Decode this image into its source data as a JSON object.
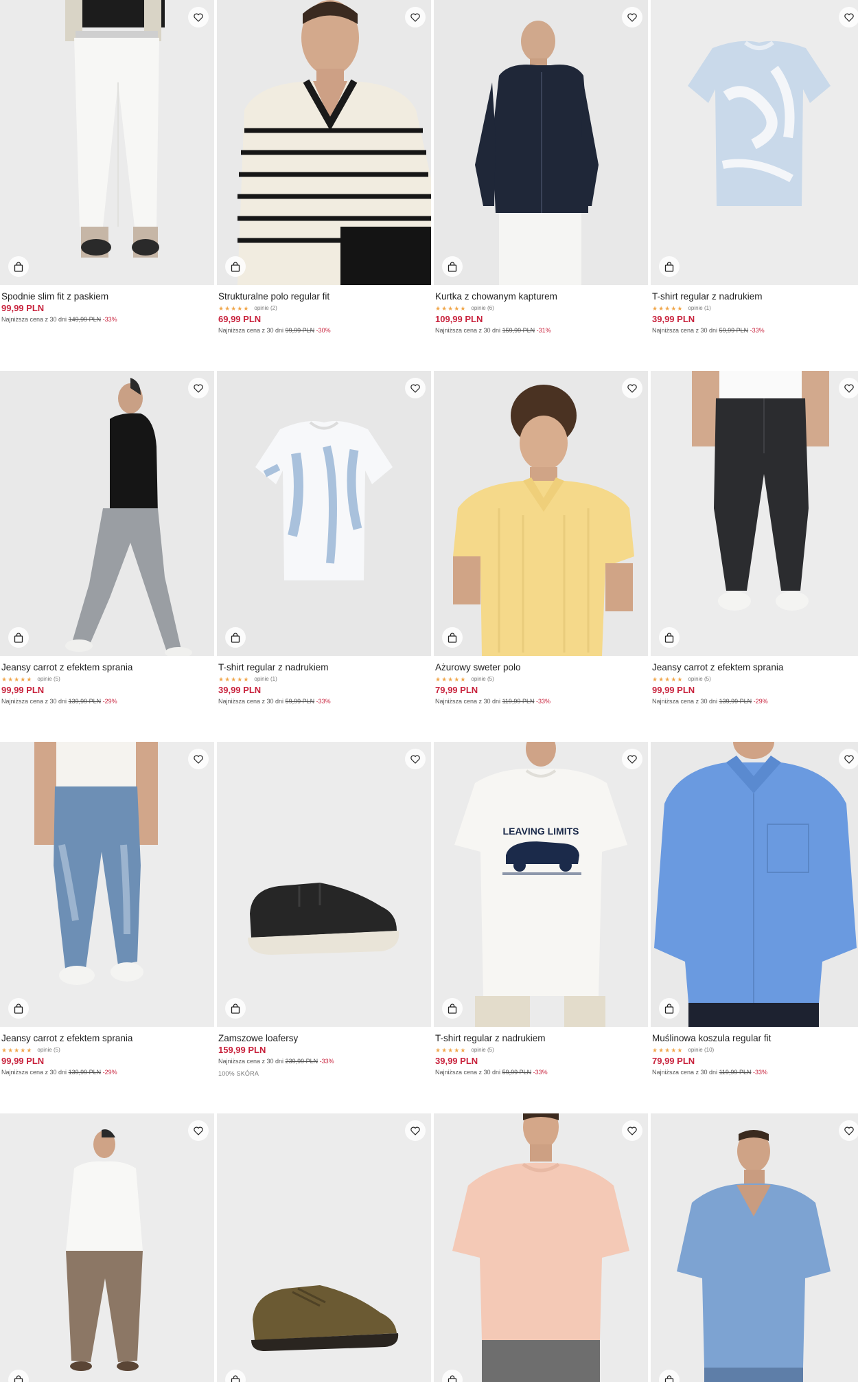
{
  "products": [
    {
      "name": "Spodnie slim fit z paskiem",
      "rating": null,
      "price": "99,99 PLN",
      "lowest_label": "Najniższa cena z 30 dni",
      "old_price": "149,99 PLN",
      "discount": "-33%"
    },
    {
      "name": "Strukturalne polo regular fit",
      "rating": {
        "stars": 5,
        "opinions": "opinie (2)"
      },
      "price": "69,99 PLN",
      "lowest_label": "Najniższa cena z 30 dni",
      "old_price": "99,99 PLN",
      "discount": "-30%"
    },
    {
      "name": "Kurtka z chowanym kapturem",
      "rating": {
        "stars": 5,
        "opinions": "opinie (6)"
      },
      "price": "109,99 PLN",
      "lowest_label": "Najniższa cena z 30 dni",
      "old_price": "159,99 PLN",
      "discount": "-31%"
    },
    {
      "name": "T-shirt regular z nadrukiem",
      "rating": {
        "stars": 5,
        "opinions": "opinie (1)"
      },
      "price": "39,99 PLN",
      "lowest_label": "Najniższa cena z 30 dni",
      "old_price": "59,99 PLN",
      "discount": "-33%"
    },
    {
      "name": "Jeansy carrot z efektem sprania",
      "rating": {
        "stars": 5,
        "opinions": "opinie (5)"
      },
      "price": "99,99 PLN",
      "lowest_label": "Najniższa cena z 30 dni",
      "old_price": "139,99 PLN",
      "discount": "-29%"
    },
    {
      "name": "T-shirt regular z nadrukiem",
      "rating": {
        "stars": 5,
        "opinions": "opinie (1)"
      },
      "price": "39,99 PLN",
      "lowest_label": "Najniższa cena z 30 dni",
      "old_price": "59,99 PLN",
      "discount": "-33%"
    },
    {
      "name": "Ażurowy sweter polo",
      "rating": {
        "stars": 5,
        "opinions": "opinie (5)"
      },
      "price": "79,99 PLN",
      "lowest_label": "Najniższa cena z 30 dni",
      "old_price": "119,99 PLN",
      "discount": "-33%"
    },
    {
      "name": "Jeansy carrot z efektem sprania",
      "rating": {
        "stars": 5,
        "opinions": "opinie (5)"
      },
      "price": "99,99 PLN",
      "lowest_label": "Najniższa cena z 30 dni",
      "old_price": "139,99 PLN",
      "discount": "-29%"
    },
    {
      "name": "Jeansy carrot z efektem sprania",
      "rating": {
        "stars": 5,
        "opinions": "opinie (5)"
      },
      "price": "99,99 PLN",
      "lowest_label": "Najniższa cena z 30 dni",
      "old_price": "139,99 PLN",
      "discount": "-29%"
    },
    {
      "name": "Zamszowe loafersy",
      "rating": null,
      "price": "159,99 PLN",
      "lowest_label": "Najniższa cena z 30 dni",
      "old_price": "239,99 PLN",
      "discount": "-33%",
      "extra": "100% SKÓRA"
    },
    {
      "name": "T-shirt regular z nadrukiem",
      "rating": {
        "stars": 5,
        "opinions": "opinie (5)"
      },
      "price": "39,99 PLN",
      "lowest_label": "Najniższa cena z 30 dni",
      "old_price": "59,99 PLN",
      "discount": "-33%",
      "print_text": "LEAVING LIMITS"
    },
    {
      "name": "Muślinowa koszula regular fit",
      "rating": {
        "stars": 5,
        "opinions": "opinie (10)"
      },
      "price": "79,99 PLN",
      "lowest_label": "Najniższa cena z 30 dni",
      "old_price": "119,99 PLN",
      "discount": "-33%"
    },
    {
      "name": "",
      "rating": null,
      "price": "",
      "lowest_label": "",
      "old_price": "",
      "discount": ""
    },
    {
      "name": "",
      "rating": null,
      "price": "",
      "lowest_label": "",
      "old_price": "",
      "discount": ""
    },
    {
      "name": "",
      "rating": null,
      "price": "",
      "lowest_label": "",
      "old_price": "",
      "discount": ""
    },
    {
      "name": "",
      "rating": null,
      "price": "",
      "lowest_label": "",
      "old_price": "",
      "discount": ""
    }
  ],
  "icons": {
    "favorite": "heart-icon",
    "add_to_bag": "shopping-bag-icon",
    "star": "star-icon"
  },
  "colors": {
    "price": "#c8223c",
    "star": "#f0a64a",
    "text": "#222222",
    "background": "#ffffff"
  }
}
